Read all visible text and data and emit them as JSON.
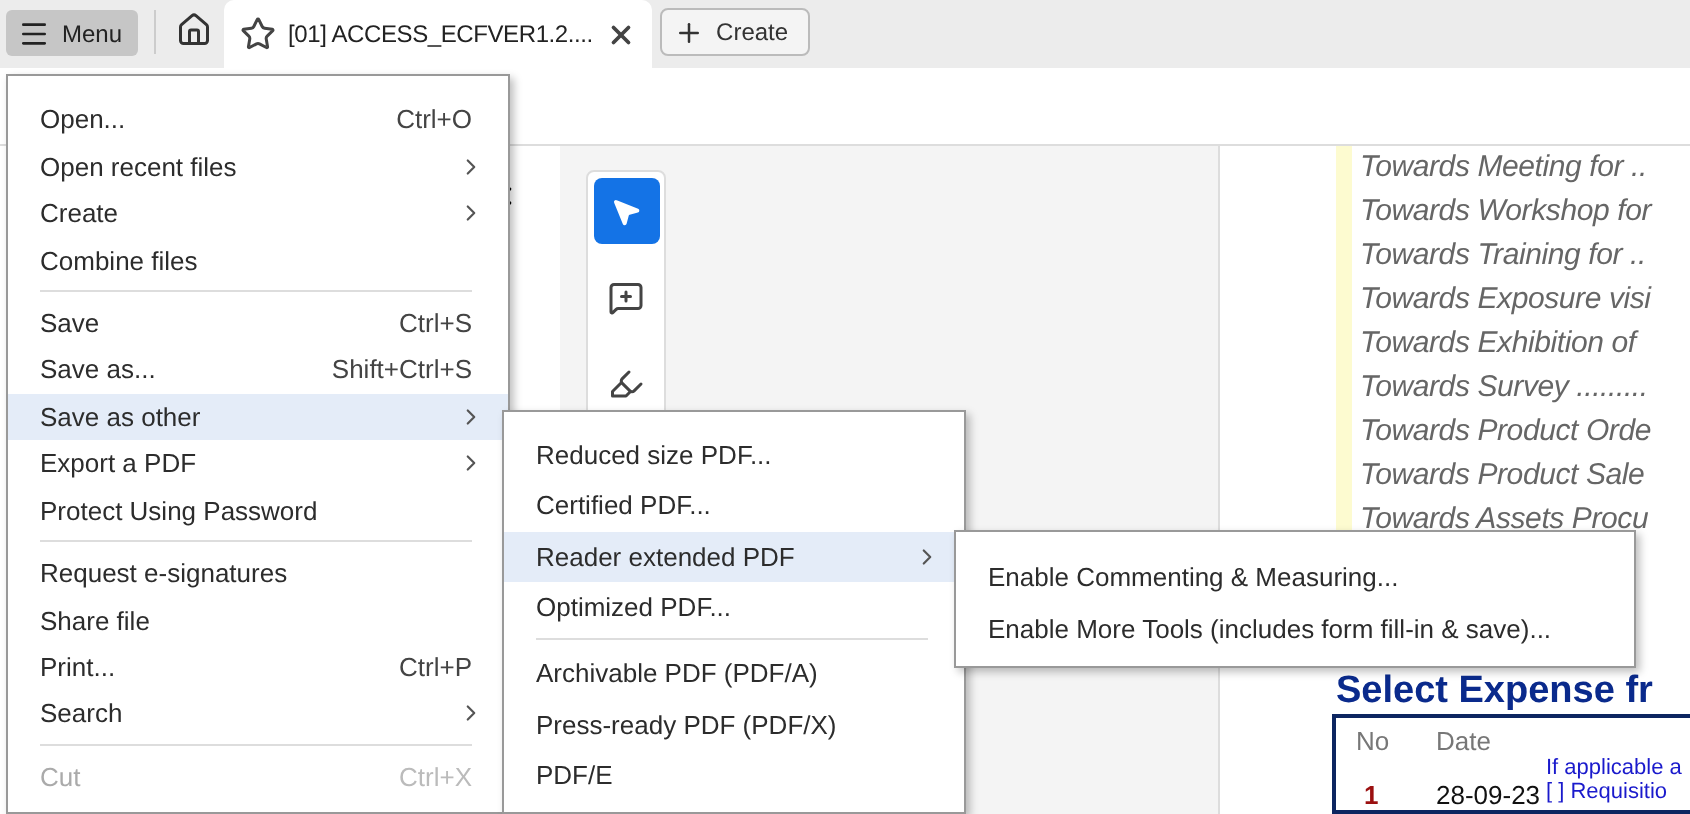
{
  "toolbar": {
    "menu_button": "Menu",
    "tab": {
      "title": "[01] ACCESS_ECFVER1.2....",
      "selected": true
    },
    "create_button": "Create"
  },
  "tools": [
    {
      "kind": "select",
      "selected": true
    },
    {
      "kind": "comment",
      "selected": false
    },
    {
      "kind": "draw",
      "selected": false
    }
  ],
  "document": {
    "lines": [
      "Towards Meeting for ..",
      "Towards Workshop for",
      "Towards Training for ..",
      "Towards Exposure visi",
      "Towards Exhibition of",
      "Towards Survey .........",
      "Towards Product Orde",
      "Towards Product Sale",
      "Towards Assets Procu"
    ],
    "heading": "Select Expense fr",
    "table": {
      "columns": [
        "No",
        "Date"
      ],
      "note": "If applicable a",
      "row": {
        "no": "1",
        "date": "28-09-23",
        "detail": "[ ] Requisitio"
      }
    }
  },
  "menu": {
    "items": [
      {
        "kind": "item",
        "label": "Open...",
        "shortcut": "Ctrl+O",
        "has_submenu": false,
        "selected": false,
        "disabled": false
      },
      {
        "kind": "item",
        "label": "Open recent files",
        "has_submenu": true,
        "selected": false,
        "disabled": false
      },
      {
        "kind": "item",
        "label": "Create",
        "has_submenu": true,
        "selected": false,
        "disabled": false
      },
      {
        "kind": "item",
        "label": "Combine files",
        "has_submenu": false,
        "selected": false,
        "disabled": false
      },
      {
        "kind": "separator"
      },
      {
        "kind": "item",
        "label": "Save",
        "shortcut": "Ctrl+S",
        "has_submenu": false,
        "selected": false,
        "disabled": false
      },
      {
        "kind": "item",
        "label": "Save as...",
        "shortcut": "Shift+Ctrl+S",
        "has_submenu": false,
        "selected": false,
        "disabled": false
      },
      {
        "kind": "item",
        "label": "Save as other",
        "has_submenu": true,
        "selected": true,
        "disabled": false,
        "submenu": [
          {
            "kind": "item",
            "label": "Reduced size PDF...",
            "has_submenu": false,
            "selected": false,
            "disabled": false
          },
          {
            "kind": "item",
            "label": "Certified PDF...",
            "has_submenu": false,
            "selected": false,
            "disabled": false
          },
          {
            "kind": "item",
            "label": "Reader extended PDF",
            "has_submenu": true,
            "selected": true,
            "disabled": false,
            "submenu": [
              {
                "kind": "item",
                "label": "Enable Commenting & Measuring...",
                "has_submenu": false,
                "selected": false,
                "disabled": false
              },
              {
                "kind": "item",
                "label": "Enable More Tools (includes form fill-in & save)...",
                "has_submenu": false,
                "selected": false,
                "disabled": false
              }
            ]
          },
          {
            "kind": "item",
            "label": "Optimized PDF...",
            "has_submenu": false,
            "selected": false,
            "disabled": false
          },
          {
            "kind": "separator"
          },
          {
            "kind": "item",
            "label": "Archivable PDF (PDF/A)",
            "has_submenu": false,
            "selected": false,
            "disabled": false
          },
          {
            "kind": "item",
            "label": "Press-ready PDF (PDF/X)",
            "has_submenu": false,
            "selected": false,
            "disabled": false
          },
          {
            "kind": "item",
            "label": "PDF/E",
            "has_submenu": false,
            "selected": false,
            "disabled": false
          }
        ]
      },
      {
        "kind": "item",
        "label": "Export a PDF",
        "has_submenu": true,
        "selected": false,
        "disabled": false
      },
      {
        "kind": "item",
        "label": "Protect Using Password",
        "has_submenu": false,
        "selected": false,
        "disabled": false
      },
      {
        "kind": "separator"
      },
      {
        "kind": "item",
        "label": "Request e-signatures",
        "has_submenu": false,
        "selected": false,
        "disabled": false
      },
      {
        "kind": "item",
        "label": "Share file",
        "has_submenu": false,
        "selected": false,
        "disabled": false
      },
      {
        "kind": "item",
        "label": "Print...",
        "shortcut": "Ctrl+P",
        "has_submenu": false,
        "selected": false,
        "disabled": false
      },
      {
        "kind": "item",
        "label": "Search",
        "has_submenu": true,
        "selected": false,
        "disabled": false
      },
      {
        "kind": "separator"
      },
      {
        "kind": "item",
        "label": "Cut",
        "shortcut": "Ctrl+X",
        "has_submenu": false,
        "selected": false,
        "disabled": true
      }
    ]
  }
}
